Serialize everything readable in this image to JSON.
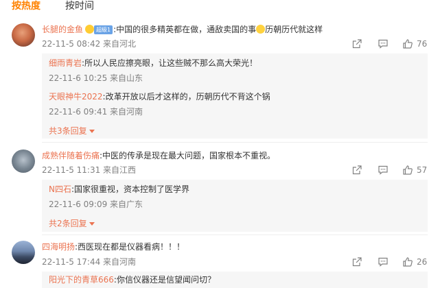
{
  "tabs": {
    "hot": "按热度",
    "time": "按时间"
  },
  "comments": [
    {
      "user": "长腿的金鱼",
      "vip": "超級1",
      "text": ":中国的很多精英都在做，通敌卖国的事",
      "text_after": "历朝历代就这样",
      "meta": "22-11-5 08:42 来自河北",
      "likes": "76",
      "replies": [
        {
          "user": "细雨青岩",
          "text": ":所以人民应擦亮眼，让这些贼不那么高大荣光！",
          "meta": "22-11-6 10:25 来自山东"
        },
        {
          "user": "天眼神牛2022",
          "text": ":改革开放以后才这样的，历朝历代不背这个锅",
          "meta": "22-11-6 09:41 来自河南"
        }
      ],
      "more": "共3条回复"
    },
    {
      "user": "成熟伴随着伤痛",
      "text": ":中医的传承是现在最大问题，国家根本不重视。",
      "meta": "22-11-5 11:31 来自江西",
      "likes": "57",
      "replies": [
        {
          "user": "N四石",
          "text": ":国家很重视，资本控制了医学界",
          "meta": "22-11-6 09:09 来自广东"
        }
      ],
      "more": "共2条回复"
    },
    {
      "user": "四海明扬",
      "text": ":西医现在都是仪器看病！！！",
      "meta": "22-11-5 17:44 来自河南",
      "likes": "26",
      "replies": [
        {
          "user": "阳光下的青草666",
          "text": ":你信仪器还是信望闻问切？"
        }
      ]
    }
  ],
  "colors": {
    "accent": "#ff8200",
    "username": "#eb7350",
    "meta": "#808080",
    "reply_bg": "#f6f6f6"
  },
  "icons": {
    "share": "share-icon",
    "reply": "comment-icon",
    "like": "thumbs-up-icon"
  }
}
